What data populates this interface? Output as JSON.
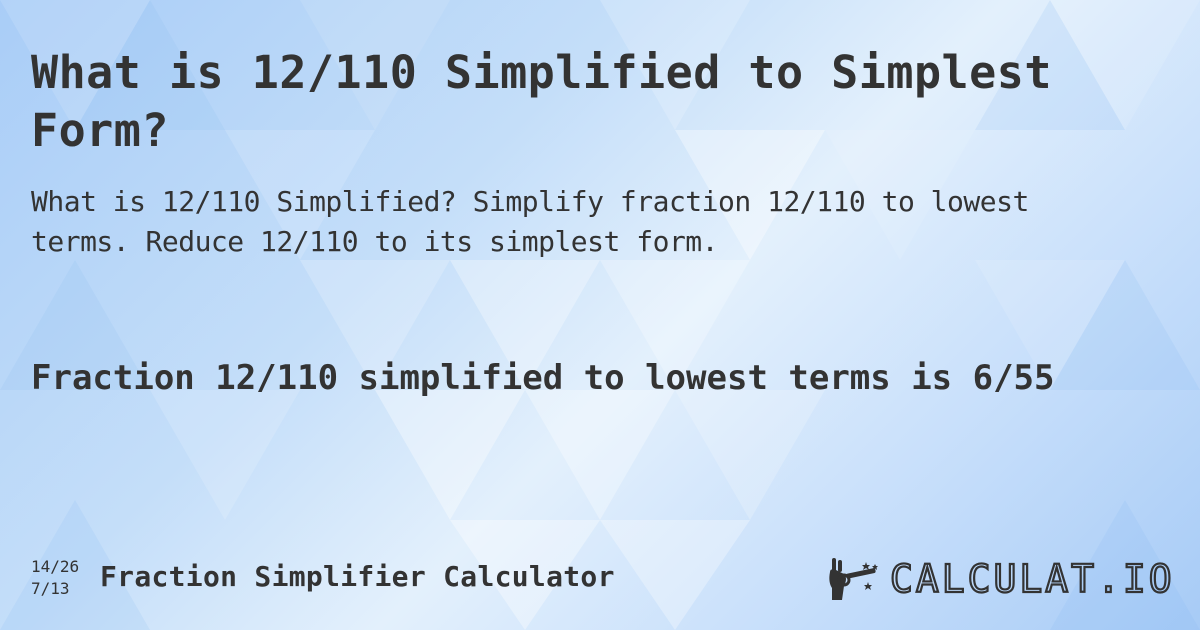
{
  "page": {
    "title": "What is 12/110 Simplified to Simplest Form?",
    "description": "What is 12/110 Simplified? Simplify fraction 12/110 to lowest terms. Reduce 12/110 to its simplest form.",
    "answer": "Fraction 12/110 simplified to lowest terms is 6/55"
  },
  "footer": {
    "fraction_top": "14/26",
    "fraction_bottom": "7/13",
    "calculator_name": "Fraction Simplifier Calculator",
    "logo_text": "CALCULAT.IO",
    "logo_icon": "magic-wand-hand-icon"
  },
  "colors": {
    "text": "#333333",
    "background_light": "#e3f0fc",
    "background_blue": "#a9cdf7"
  }
}
